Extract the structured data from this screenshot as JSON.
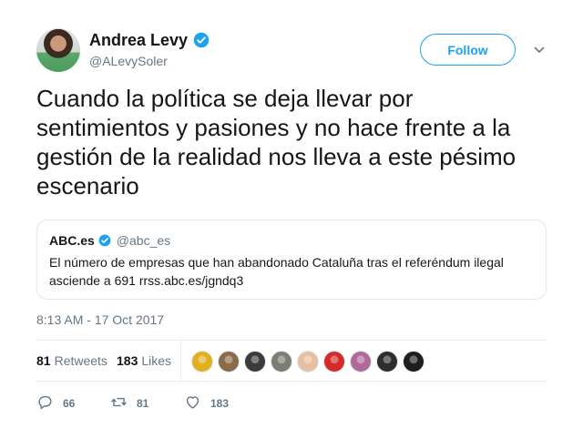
{
  "author": {
    "display_name": "Andrea Levy",
    "handle": "@ALevySoler",
    "avatar_icon": "user-avatar"
  },
  "follow_label": "Follow",
  "tweet_text": "Cuando la política se deja llevar por sentimientos y pasiones y no hace frente a la gestión de la realidad nos lleva a este pésimo escenario",
  "quoted": {
    "name": "ABC.es",
    "handle": "@abc_es",
    "text": "El número de empresas que han abandonado Cataluña tras el referéndum ilegal asciende a 691 rrss.abc.es/jgndq3"
  },
  "timestamp": "8:13 AM - 17 Oct 2017",
  "stats": {
    "retweets_count": "81",
    "retweets_label": "Retweets",
    "likes_count": "183",
    "likes_label": "Likes"
  },
  "likers": [
    {
      "color": "#e0b020"
    },
    {
      "color": "#8a6a48"
    },
    {
      "color": "#3b3b3b"
    },
    {
      "color": "#7d7d72"
    },
    {
      "color": "#e8c0a0"
    },
    {
      "color": "#d42a2a"
    },
    {
      "color": "#b06a9a"
    },
    {
      "color": "#2e2e2e"
    },
    {
      "color": "#1e1e1e"
    }
  ],
  "actions": {
    "replies": "66",
    "retweets": "81",
    "likes": "183"
  },
  "colors": {
    "accent": "#1da1f2",
    "secondary_text": "#657786",
    "border": "#e1e8ed"
  }
}
